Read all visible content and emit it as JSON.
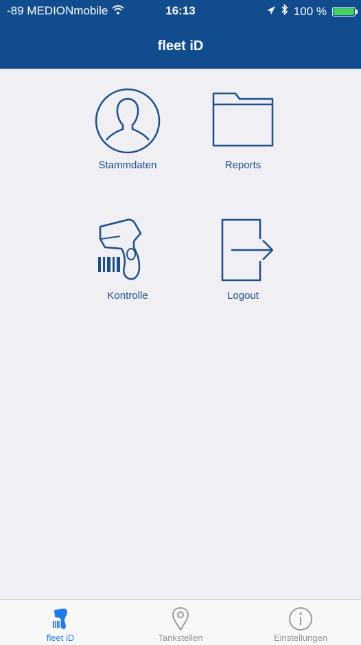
{
  "status_bar": {
    "carrier": "-89 MEDIONmobile",
    "time": "16:13",
    "battery": "100 %"
  },
  "nav": {
    "title": "fleet iD"
  },
  "tiles": [
    {
      "label": "Stammdaten",
      "icon": "person-icon"
    },
    {
      "label": "Reports",
      "icon": "folder-icon"
    },
    {
      "label": "Kontrolle",
      "icon": "barcode-scanner-icon"
    },
    {
      "label": "Logout",
      "icon": "logout-icon"
    }
  ],
  "tabbar": {
    "tabs": [
      {
        "label": "fleet iD",
        "icon": "scanner-tab-icon",
        "active": true
      },
      {
        "label": "Tankstellen",
        "icon": "location-pin-icon",
        "active": false
      },
      {
        "label": "Einstellungen",
        "icon": "info-icon",
        "active": false
      }
    ]
  },
  "colors": {
    "nav_bg": "#114c8e",
    "icon_blue": "#1a4f8b",
    "tab_active": "#1d7af0",
    "tab_inactive": "#929297",
    "background": "#efeff4"
  }
}
